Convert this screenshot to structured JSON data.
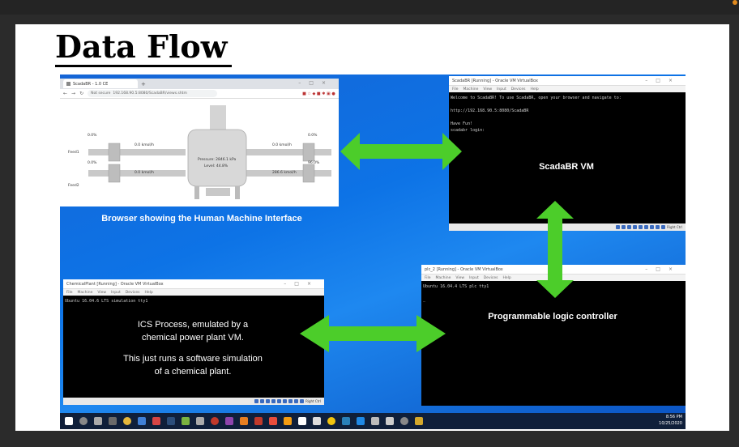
{
  "slide": {
    "title": "Data Flow"
  },
  "browser": {
    "tab_title": "ScadaBR - 1.0 CE",
    "not_secure": "Not secure",
    "url": "192.168.90.5:8080/ScadaBR/views.shtm",
    "hmi": {
      "pct_top_left": "0.0%",
      "flow_top_left": "0.0 kmol/h",
      "feed1": "Feed1",
      "pct_mid_left": "0.0%",
      "flow_mid_left": "0.0 kmol/h",
      "feed2": "Feed2",
      "pressure": "Pressure: 2846.1 kPa",
      "level": "Level: 44.8%",
      "flow_top_right": "0.0 kmol/h",
      "pct_top_right": "0.0%",
      "flow_mid_right": "286.6 kmol/h",
      "pct_mid_right": "96.0%"
    },
    "caption": "Browser showing the Human Machine Interface"
  },
  "scadabr_vm": {
    "title": "ScadaBR [Running] - Oracle VM VirtualBox",
    "menu": [
      "File",
      "Machine",
      "View",
      "Input",
      "Devices",
      "Help"
    ],
    "terminal_lines": [
      "Welcome to ScadaBR! To use ScadaBR, open your browser and navigate to:",
      "",
      "http://192.168.90.5:8080/ScadaBR",
      "",
      "Have Fun!",
      "scadabr login:"
    ],
    "label": "ScadaBR VM",
    "status_text": "Right Ctrl"
  },
  "plc_vm": {
    "title": "plc_2 [Running] - Oracle VM VirtualBox",
    "menu": [
      "File",
      "Machine",
      "View",
      "Input",
      "Devices",
      "Help"
    ],
    "terminal_lines": [
      "Ubuntu 16.04.4 LTS plc tty1",
      "",
      "_"
    ],
    "label": "Programmable logic controller",
    "status_text": "Right Ctrl"
  },
  "chem_vm": {
    "title": "ChemicalPlant [Running] - Oracle VM VirtualBox",
    "menu": [
      "File",
      "Machine",
      "View",
      "Input",
      "Devices",
      "Help"
    ],
    "terminal_lines": [
      "Ubuntu 16.04.6 LTS simulation tty1"
    ],
    "label_line1": "ICS Process, emulated by a",
    "label_line2": "chemical power plant VM.",
    "label_line3": "This just runs a software simulation",
    "label_line4": "of a chemical plant.",
    "status_text": "Right Ctrl"
  },
  "taskbar": {
    "time": "8:56 PM",
    "date": "10/25/2020"
  },
  "colors": {
    "arrow": "#4ccd2a",
    "desktop": "#0d73e6",
    "terminal": "#000000"
  }
}
